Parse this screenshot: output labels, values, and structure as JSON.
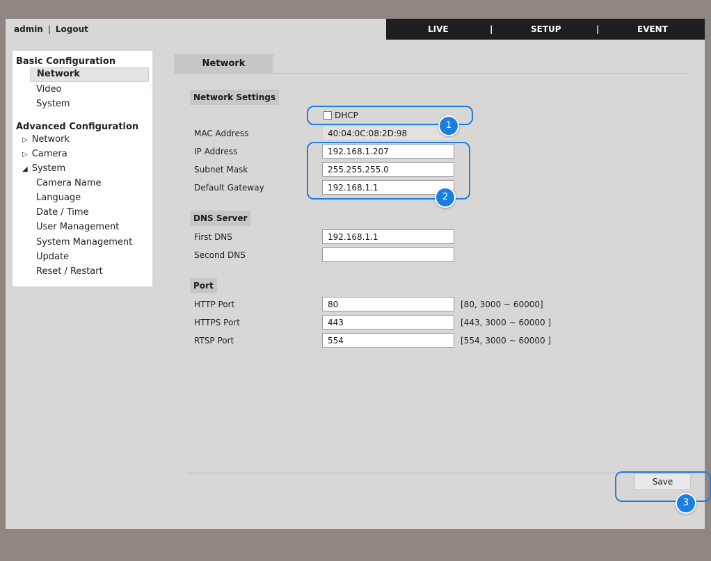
{
  "header": {
    "user": "admin",
    "separator": "|",
    "logout": "Logout",
    "nav": {
      "live": "LIVE",
      "setup": "SETUP",
      "event": "EVENT",
      "separator": "|"
    }
  },
  "sidebar": {
    "basic_title": "Basic Configuration",
    "basic_items": [
      "Network",
      "Video",
      "System"
    ],
    "advanced_title": "Advanced Configuration",
    "advanced_tree": [
      {
        "label": "Network",
        "icon": "triangle-right-outline-icon"
      },
      {
        "label": "Camera",
        "icon": "triangle-right-outline-icon"
      },
      {
        "label": "System",
        "icon": "triangle-down-filled-icon"
      }
    ],
    "system_items": [
      "Camera Name",
      "Language",
      "Date / Time",
      "User Management",
      "System Management",
      "Update",
      "Reset / Restart"
    ]
  },
  "main": {
    "tab": "Network",
    "network_settings": {
      "title": "Network Settings",
      "dhcp_label": "DHCP",
      "mac_label": "MAC Address",
      "mac_value": "40:04:0C:08:2D:98",
      "ip_label": "IP Address",
      "ip_value": "192.168.1.207",
      "subnet_label": "Subnet Mask",
      "subnet_value": "255.255.255.0",
      "gateway_label": "Default Gateway",
      "gateway_value": "192.168.1.1"
    },
    "dns": {
      "title": "DNS Server",
      "first_label": "First DNS",
      "first_value": "192.168.1.1",
      "second_label": "Second DNS",
      "second_value": ""
    },
    "port": {
      "title": "Port",
      "http_label": "HTTP Port",
      "http_value": "80",
      "http_range": "[80, 3000 ~ 60000]",
      "https_label": "HTTPS Port",
      "https_value": "443",
      "https_range": "[443, 3000 ~ 60000 ]",
      "rtsp_label": "RTSP Port",
      "rtsp_value": "554",
      "rtsp_range": "[554, 3000 ~ 60000 ]"
    },
    "save_label": "Save"
  },
  "callouts": [
    "1",
    "2",
    "3"
  ],
  "colors": {
    "accent": "#1a7fe0",
    "frame": "#8f8682",
    "panel": "#d8d7d6",
    "topnav": "#1e1e1e"
  }
}
